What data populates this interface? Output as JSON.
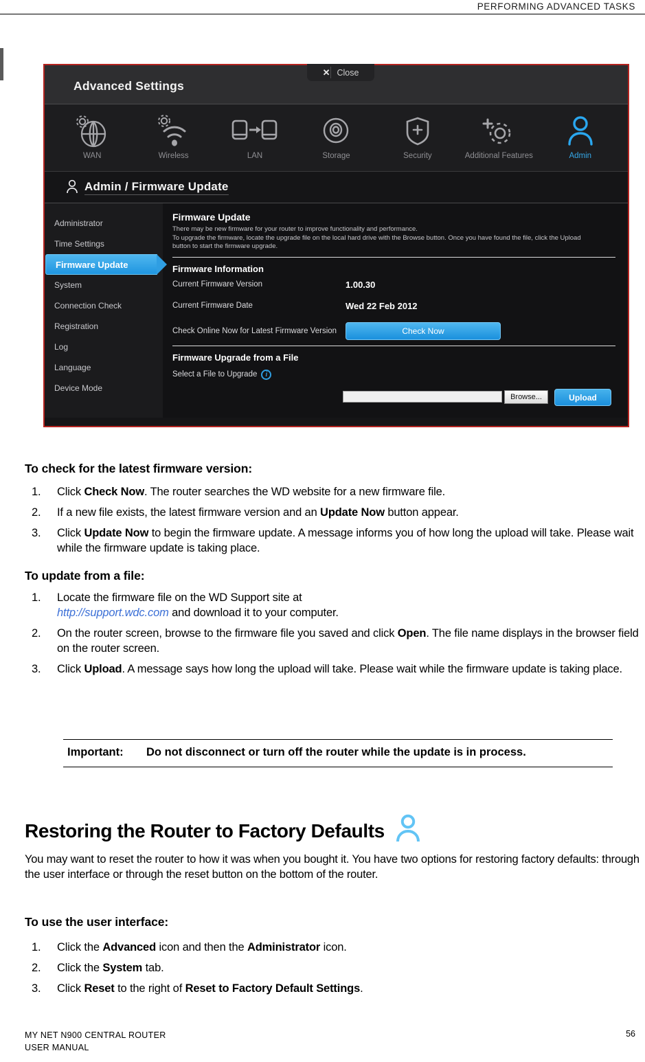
{
  "running_head": "PERFORMING ADVANCED TASKS",
  "figure": {
    "title": "Advanced Settings",
    "close_label": "Close",
    "close_x": "✕",
    "nav": [
      {
        "label": "WAN",
        "icon": "globe-gear-icon",
        "active": false
      },
      {
        "label": "Wireless",
        "icon": "wifi-gear-icon",
        "active": false
      },
      {
        "label": "LAN",
        "icon": "lan-transfer-icon",
        "active": false
      },
      {
        "label": "Storage",
        "icon": "disc-icon",
        "active": false
      },
      {
        "label": "Security",
        "icon": "shield-plus-icon",
        "active": false
      },
      {
        "label": "Additional Features",
        "icon": "gear-plus-icon",
        "active": false
      },
      {
        "label": "Admin",
        "icon": "person-icon",
        "active": true
      }
    ],
    "breadcrumb": "Admin / Firmware Update",
    "breadcrumb_icon": "person-icon",
    "sidebar": [
      {
        "label": "Administrator",
        "active": false
      },
      {
        "label": "Time Settings",
        "active": false
      },
      {
        "label": "Firmware Update",
        "active": true
      },
      {
        "label": "System",
        "active": false
      },
      {
        "label": "Connection Check",
        "active": false
      },
      {
        "label": "Registration",
        "active": false
      },
      {
        "label": "Log",
        "active": false
      },
      {
        "label": "Language",
        "active": false
      },
      {
        "label": "Device Mode",
        "active": false
      }
    ],
    "panel": {
      "heading": "Firmware Update",
      "description_line1": "There may be new firmware for your router to improve functionality and performance.",
      "description_line2": "To upgrade the firmware, locate the upgrade file on the local hard drive with the Browse button. Once you have found the file, click the Upload",
      "description_line3": "button to start the firmware upgrade.",
      "info_heading": "Firmware Information",
      "version_label": "Current Firmware Version",
      "version_value": "1.00.30",
      "date_label": "Current Firmware Date",
      "date_value": "Wed 22 Feb 2012",
      "check_label": "Check Online Now for Latest Firmware Version",
      "check_button": "Check Now",
      "upgrade_heading": "Firmware Upgrade from a File",
      "select_file_label": "Select a File to Upgrade",
      "info_icon": "info-circle-icon",
      "file_value": "",
      "file_placeholder": "",
      "browse_button": "Browse...",
      "upload_button": "Upload"
    },
    "accent_blue": "#2f9ee2",
    "border_red": "#b4231f"
  },
  "sections": [
    {
      "heading": "To check for the latest firmware version:",
      "steps": [
        {
          "num": "1.",
          "html": "Click <b>Check Now</b>. The router searches the WD website for a new firmware file."
        },
        {
          "num": "2.",
          "html": "If a new file exists, the latest firmware version and an <b>Update Now</b> button appear."
        },
        {
          "num": "3.",
          "html": "Click <b>Update Now</b> to begin the firmware update. A message informs you of how long the upload will take. Please wait while the firmware update is taking place."
        }
      ]
    },
    {
      "heading": "To update from a file:",
      "steps": [
        {
          "num": "1.",
          "html": "Locate the firmware file on the WD Support site at<br><span class=\"lnk\">http://support.wdc.com</span> and download it to your computer."
        },
        {
          "num": "2.",
          "html": "On the router screen, browse to the firmware file you saved and click <b>Open</b>. The file name displays in the browser field on the router screen."
        },
        {
          "num": "3.",
          "html": "Click <b>Upload</b>. A message says how long the upload will take. Please wait while the firmware update is taking place."
        }
      ]
    }
  ],
  "important": {
    "label": "Important:",
    "text": "Do not disconnect or turn off the router while the update is in process."
  },
  "restore": {
    "heading": "Restoring the Router to Factory Defaults",
    "heading_icon": "person-icon",
    "paragraph": "You may want to reset the router to how it was when you bought it. You have two options for restoring factory defaults: through the user interface or through the reset button on the bottom of the router.",
    "sub_heading": "To use the user interface:",
    "steps": [
      {
        "num": "1.",
        "html": "Click the <b>Advanced</b> icon and then the <b>Administrator</b> icon."
      },
      {
        "num": "2.",
        "html": "Click the <b>System</b> tab."
      },
      {
        "num": "3.",
        "html": "Click <b>Reset</b> to the right of <b>Reset to Factory Default Settings</b>."
      }
    ]
  },
  "footer": {
    "line1": "MY NET N900 CENTRAL ROUTER",
    "line2": "USER MANUAL",
    "page": "56"
  }
}
